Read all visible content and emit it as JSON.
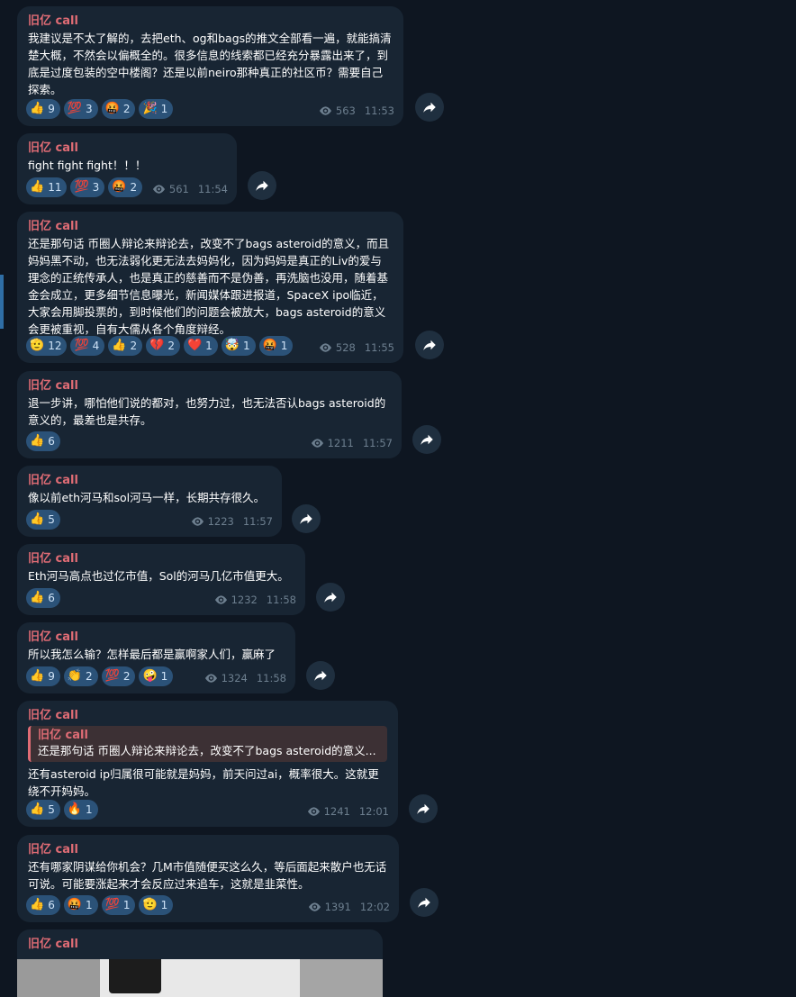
{
  "messages": [
    {
      "author": "旧亿 call",
      "text": "我建议是不太了解的，去把eth、og和bags的推文全部看一遍，就能搞清楚大概，不然会以偏概全的。很多信息的线索都已经充分暴露出来了，到底是过度包装的空中楼阁？还是以前neiro那种真正的社区币？需要自己探索。",
      "reactions": [
        {
          "emoji": "👍",
          "count": "9"
        },
        {
          "emoji": "💯",
          "count": "3"
        },
        {
          "emoji": "🤬",
          "count": "2"
        },
        {
          "emoji": "🎉",
          "count": "1"
        }
      ],
      "views": "563",
      "time": "11:53"
    },
    {
      "author": "旧亿 call",
      "text": "fight fight fight！！！",
      "reactions": [
        {
          "emoji": "👍",
          "count": "11"
        },
        {
          "emoji": "💯",
          "count": "3"
        },
        {
          "emoji": "🤬",
          "count": "2"
        }
      ],
      "views": "561",
      "time": "11:54"
    },
    {
      "author": "旧亿 call",
      "text": "还是那句话 币圈人辩论来辩论去，改变不了bags asteroid的意义，而且妈妈黑不动，也无法弱化更无法去妈妈化，因为妈妈是真正的Liv的爱与理念的正统传承人，也是真正的慈善而不是伪善，再洗脑也没用，随着基金会成立，更多细节信息曝光，新闻媒体跟进报道，SpaceX ipo临近，大家会用脚投票的，到时候他们的问题会被放大，bags asteroid的意义会更被重视，自有大儒从各个角度辩经。",
      "reactions": [
        {
          "emoji": "🫡",
          "count": "12"
        },
        {
          "emoji": "💯",
          "count": "4"
        },
        {
          "emoji": "👍",
          "count": "2"
        },
        {
          "emoji": "💔",
          "count": "2"
        },
        {
          "emoji": "❤️",
          "count": "1"
        },
        {
          "emoji": "🤯",
          "count": "1"
        },
        {
          "emoji": "🤬",
          "count": "1"
        }
      ],
      "views": "528",
      "time": "11:55"
    },
    {
      "author": "旧亿 call",
      "text": "退一步讲，哪怕他们说的都对，也努力过，也无法否认bags asteroid的意义的，最差也是共存。",
      "reactions": [
        {
          "emoji": "👍",
          "count": "6"
        }
      ],
      "views": "1211",
      "time": "11:57"
    },
    {
      "author": "旧亿 call",
      "text": "像以前eth河马和sol河马一样，长期共存很久。",
      "reactions": [
        {
          "emoji": "👍",
          "count": "5"
        }
      ],
      "views": "1223",
      "time": "11:57"
    },
    {
      "author": "旧亿 call",
      "text": "Eth河马高点也过亿市值，Sol的河马几亿市值更大。",
      "reactions": [
        {
          "emoji": "👍",
          "count": "6"
        }
      ],
      "views": "1232",
      "time": "11:58"
    },
    {
      "author": "旧亿 call",
      "text": "所以我怎么输？怎样最后都是赢啊家人们，赢麻了",
      "reactions": [
        {
          "emoji": "👍",
          "count": "9"
        },
        {
          "emoji": "👏",
          "count": "2"
        },
        {
          "emoji": "💯",
          "count": "2"
        },
        {
          "emoji": "🤪",
          "count": "1"
        }
      ],
      "views": "1324",
      "time": "11:58"
    },
    {
      "author": "旧亿 call",
      "quote_author": "旧亿 call",
      "quote_text": "还是那句话 币圈人辩论来辩论去，改变不了bags asteroid的意义...",
      "text": "还有asteroid ip归属很可能就是妈妈，前天问过ai，概率很大。这就更绕不开妈妈。",
      "reactions": [
        {
          "emoji": "👍",
          "count": "5"
        },
        {
          "emoji": "🔥",
          "count": "1"
        }
      ],
      "views": "1241",
      "time": "12:01"
    },
    {
      "author": "旧亿 call",
      "text": "还有哪家阴谋给你机会？几M市值随便买这么久，等后面起来散户也无话可说。可能要涨起来才会反应过来追车，这就是韭菜性。",
      "reactions": [
        {
          "emoji": "👍",
          "count": "6"
        },
        {
          "emoji": "🤬",
          "count": "1"
        },
        {
          "emoji": "💯",
          "count": "1"
        },
        {
          "emoji": "🫡",
          "count": "1"
        }
      ],
      "views": "1391",
      "time": "12:02"
    },
    {
      "author": "旧亿 call"
    }
  ],
  "colors": {
    "background": "#0e1621",
    "bubble": "#182533",
    "author": "#e06c75",
    "reaction_bg": "#2b5278",
    "meta": "#6d7f8f"
  },
  "icons": {
    "views": "eye-icon",
    "share": "share-arrow-icon"
  }
}
